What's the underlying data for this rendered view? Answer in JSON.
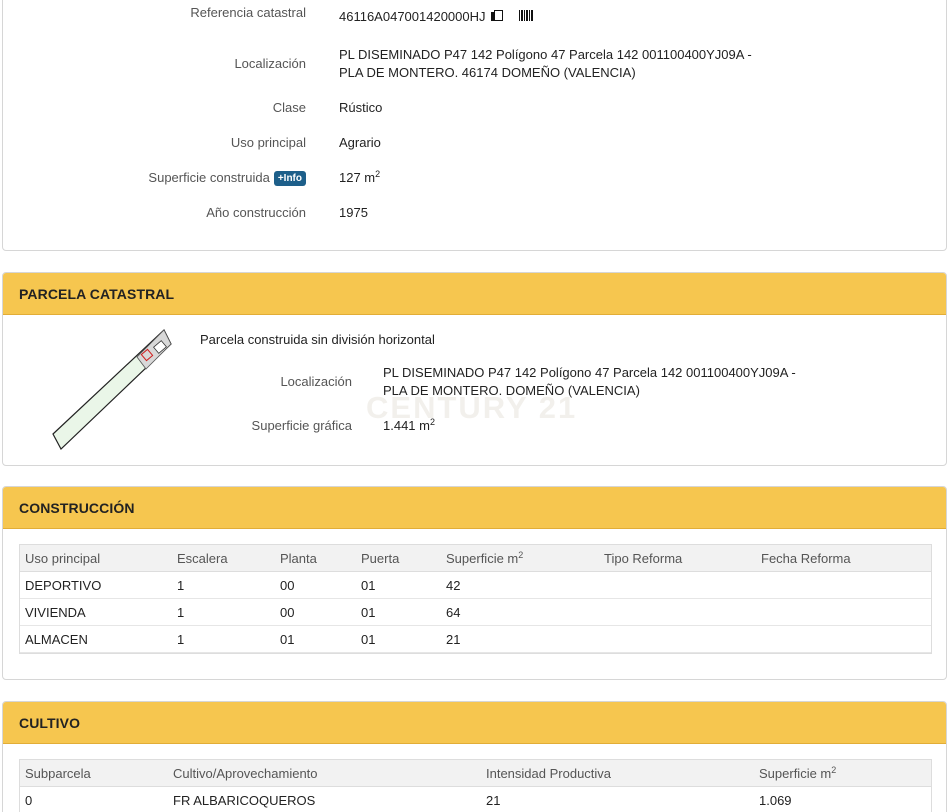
{
  "inmueble": {
    "referencia": {
      "label": "Referencia catastral",
      "value": "46116A047001420000HJ"
    },
    "localizacion": {
      "label": "Localización",
      "line1": "PL DISEMINADO P47 142 Polígono 47 Parcela 142 001100400YJ09A -",
      "line2": "PLA DE MONTERO. 46174 DOMEÑO (VALENCIA)"
    },
    "clase": {
      "label": "Clase",
      "value": "Rústico"
    },
    "uso": {
      "label": "Uso principal",
      "value": "Agrario"
    },
    "superficie": {
      "label": "Superficie construida",
      "info_badge": "+Info",
      "value": "127 m",
      "unit_exp": "2"
    },
    "anio": {
      "label": "Año construcción",
      "value": "1975"
    }
  },
  "parcela": {
    "title": "PARCELA CATASTRAL",
    "description": "Parcela construida sin división horizontal",
    "localizacion": {
      "label": "Localización",
      "line1": "PL DISEMINADO P47 142 Polígono 47 Parcela 142 001100400YJ09A -",
      "line2": "PLA DE MONTERO. DOMEÑO (VALENCIA)"
    },
    "superficie": {
      "label": "Superficie gráfica",
      "value": "1.441 m",
      "unit_exp": "2"
    }
  },
  "watermark": "CENTURY 21",
  "construccion": {
    "title": "CONSTRUCCIÓN",
    "headers": [
      "Uso principal",
      "Escalera",
      "Planta",
      "Puerta",
      "Superficie m",
      "Tipo Reforma",
      "Fecha Reforma"
    ],
    "header_exp": "2",
    "rows": [
      [
        "DEPORTIVO",
        "1",
        "00",
        "01",
        "42",
        "",
        ""
      ],
      [
        "VIVIENDA",
        "1",
        "00",
        "01",
        "64",
        "",
        ""
      ],
      [
        "ALMACEN",
        "1",
        "01",
        "01",
        "21",
        "",
        ""
      ]
    ]
  },
  "cultivo": {
    "title": "CULTIVO",
    "headers": [
      "Subparcela",
      "Cultivo/Aprovechamiento",
      "Intensidad Productiva",
      "Superficie m"
    ],
    "header_exp": "2",
    "rows": [
      [
        "0",
        "FR ALBARICOQUEROS",
        "21",
        "1.069"
      ]
    ]
  },
  "colors": {
    "header_yellow": "#f6c64f",
    "badge_blue": "#1d5f8a"
  }
}
